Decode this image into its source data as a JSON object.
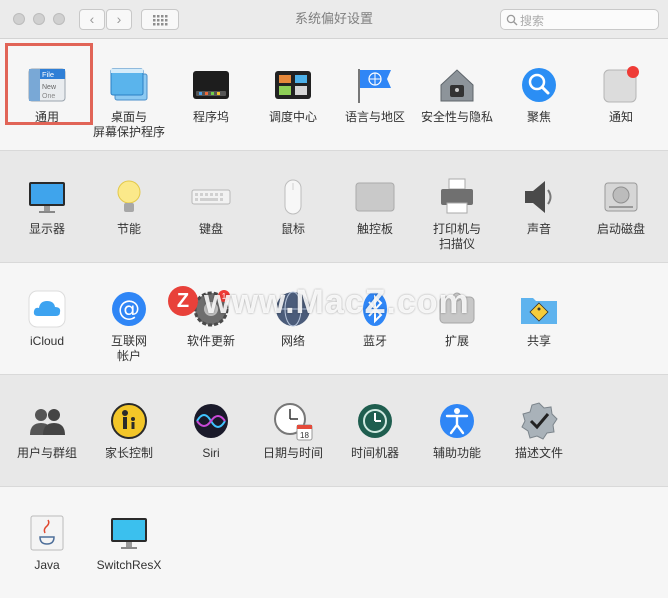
{
  "window": {
    "title": "系统偏好设置"
  },
  "search": {
    "placeholder": "搜索"
  },
  "watermark": {
    "text": "www.MacZ.com",
    "logo_letter": "Z"
  },
  "colors": {
    "accent": "#2f86f6",
    "highlight": "#e16457",
    "badge": "#ef3b36"
  },
  "sections": [
    {
      "items": [
        {
          "id": "general",
          "label": "通用",
          "icon": "general-icon",
          "icon_text": [
            "File",
            "New",
            "One"
          ]
        },
        {
          "id": "desktop",
          "label": "桌面与\n屏幕保护程序",
          "icon": "desktop-screensaver-icon"
        },
        {
          "id": "dock",
          "label": "程序坞",
          "icon": "dock-icon"
        },
        {
          "id": "mission",
          "label": "调度中心",
          "icon": "mission-control-icon"
        },
        {
          "id": "language",
          "label": "语言与地区",
          "icon": "globe-flag-icon"
        },
        {
          "id": "security",
          "label": "安全性与隐私",
          "icon": "house-lock-icon"
        },
        {
          "id": "spotlight",
          "label": "聚焦",
          "icon": "magnifier-icon"
        },
        {
          "id": "notifications",
          "label": "通知",
          "icon": "notifications-icon"
        }
      ]
    },
    {
      "items": [
        {
          "id": "displays",
          "label": "显示器",
          "icon": "display-icon"
        },
        {
          "id": "energy",
          "label": "节能",
          "icon": "lightbulb-icon"
        },
        {
          "id": "keyboard",
          "label": "键盘",
          "icon": "keyboard-icon"
        },
        {
          "id": "mouse",
          "label": "鼠标",
          "icon": "mouse-icon"
        },
        {
          "id": "trackpad",
          "label": "触控板",
          "icon": "trackpad-icon"
        },
        {
          "id": "printers",
          "label": "打印机与\n扫描仪",
          "icon": "printer-icon"
        },
        {
          "id": "sound",
          "label": "声音",
          "icon": "speaker-icon"
        },
        {
          "id": "startup",
          "label": "启动磁盘",
          "icon": "hard-disk-icon"
        }
      ]
    },
    {
      "items": [
        {
          "id": "icloud",
          "label": "iCloud",
          "icon": "icloud-icon"
        },
        {
          "id": "internet",
          "label": "互联网\n帐户",
          "icon": "at-sign-icon"
        },
        {
          "id": "update",
          "label": "软件更新",
          "icon": "gear-update-icon",
          "badge": "1"
        },
        {
          "id": "network",
          "label": "网络",
          "icon": "network-globe-icon"
        },
        {
          "id": "bluetooth",
          "label": "蓝牙",
          "icon": "bluetooth-icon"
        },
        {
          "id": "extensions",
          "label": "扩展",
          "icon": "puzzle-icon"
        },
        {
          "id": "sharing",
          "label": "共享",
          "icon": "sharing-folder-icon"
        }
      ]
    },
    {
      "items": [
        {
          "id": "users",
          "label": "用户与群组",
          "icon": "users-icon"
        },
        {
          "id": "parental",
          "label": "家长控制",
          "icon": "parental-controls-icon"
        },
        {
          "id": "siri",
          "label": "Siri",
          "icon": "siri-icon"
        },
        {
          "id": "datetime",
          "label": "日期与时间",
          "icon": "clock-calendar-icon",
          "calendar_day": "18"
        },
        {
          "id": "timemachine",
          "label": "时间机器",
          "icon": "time-machine-icon"
        },
        {
          "id": "accessibility",
          "label": "辅助功能",
          "icon": "accessibility-icon"
        },
        {
          "id": "profiles",
          "label": "描述文件",
          "icon": "checkmark-badge-icon"
        }
      ]
    },
    {
      "items": [
        {
          "id": "java",
          "label": "Java",
          "icon": "java-icon"
        },
        {
          "id": "switchresx",
          "label": "SwitchResX",
          "icon": "switchresx-monitor-icon"
        }
      ]
    }
  ]
}
